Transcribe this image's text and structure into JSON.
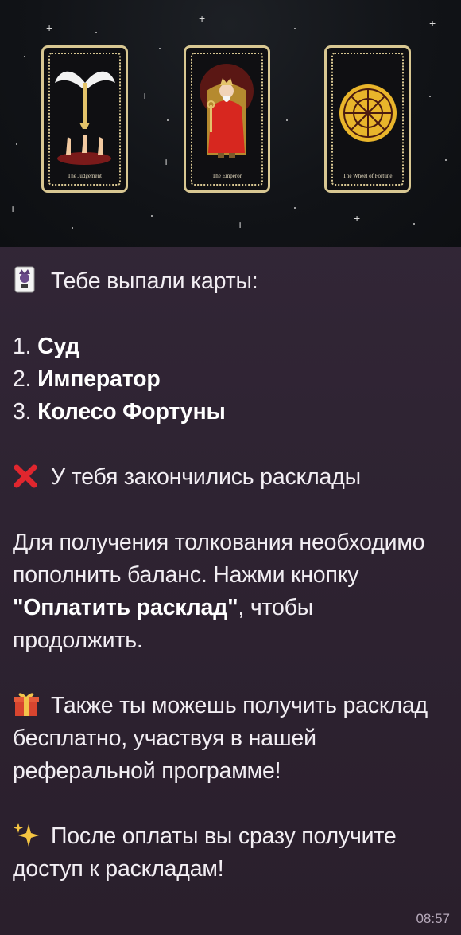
{
  "cards": [
    {
      "caption": "The Judgement"
    },
    {
      "caption": "The Emperor"
    },
    {
      "caption": "The Wheel of Fortune"
    }
  ],
  "message": {
    "intro": "Тебе выпали карты:",
    "list": [
      {
        "num": "1. ",
        "name": "Суд"
      },
      {
        "num": "2. ",
        "name": "Император"
      },
      {
        "num": "3. ",
        "name": "Колесо Фортуны"
      }
    ],
    "no_spreads": "У тебя закончились расклады",
    "pay_text_1": "Для получения толкования необходимо пополнить баланс. Нажми кнопку ",
    "pay_button_name": "\"Оплатить расклад\"",
    "pay_text_2": ", чтобы продолжить.",
    "referral": "Также ты можешь получить расклад бесплатно, участвуя в нашей реферальной программе!",
    "after_pay": "После оплаты вы сразу получите доступ к раскладам!",
    "time": "08:57"
  },
  "icons": {
    "joker": "joker-card-icon",
    "cross": "red-cross-icon",
    "gift": "gift-icon",
    "sparkles": "sparkles-icon"
  },
  "colors": {
    "gold": "#d8c792",
    "cross": "#e0262e",
    "gift": "#d8452f"
  }
}
